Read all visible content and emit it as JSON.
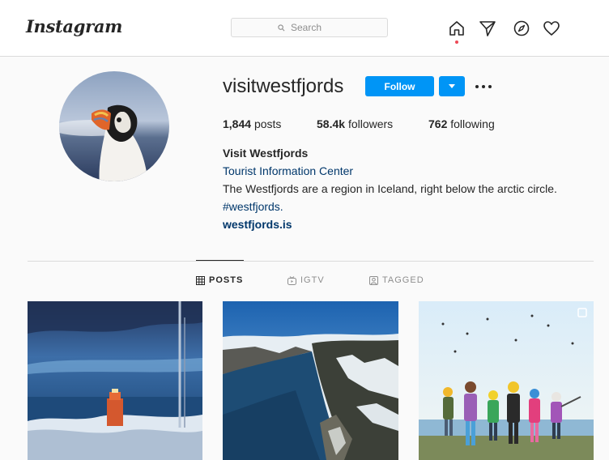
{
  "header": {
    "logo_text": "Instagram",
    "search": {
      "placeholder": "Search"
    },
    "nav_icons": [
      "home-icon",
      "direct-icon",
      "explore-icon",
      "activity-heart-icon"
    ]
  },
  "profile": {
    "username": "visitwestfjords",
    "follow_label": "Follow",
    "stats": {
      "posts_count": "1,844",
      "posts_label": "posts",
      "followers_count": "58.4k",
      "followers_label": "followers",
      "following_count": "762",
      "following_label": "following"
    },
    "full_name": "Visit Westfjords",
    "category": "Tourist Information Center",
    "bio": "The Westfjords are a region in Iceland, right below the arctic circle.",
    "hashtag": "#westfjords.",
    "website": "westfjords.is"
  },
  "tabs": [
    {
      "label": "POSTS",
      "icon": "grid-icon",
      "active": true
    },
    {
      "label": "IGTV",
      "icon": "igtv-icon",
      "active": false
    },
    {
      "label": "TAGGED",
      "icon": "tagged-icon",
      "active": false
    }
  ],
  "posts": [
    {
      "content": "lighthouse-dusk-photo"
    },
    {
      "content": "fjord-aerial-photo"
    },
    {
      "content": "kids-helmets-photo",
      "multi": true
    }
  ],
  "colors": {
    "accent": "#0095f6",
    "link": "#00376b",
    "notification_dot": "#ed4956",
    "background": "#fafafa",
    "border": "#dbdbdb"
  }
}
